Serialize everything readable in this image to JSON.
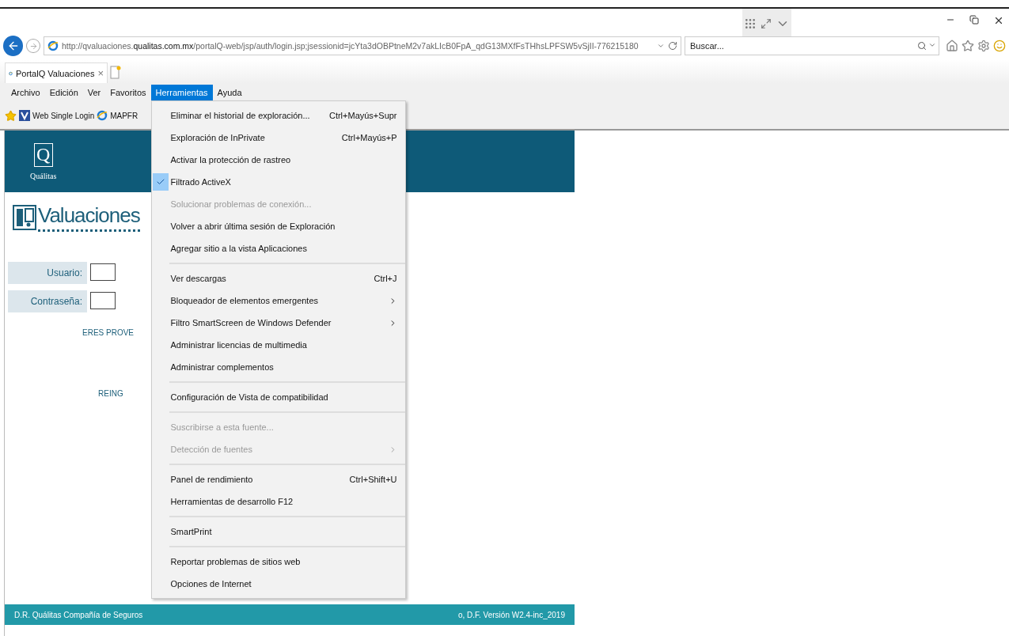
{
  "browser": {
    "address": "http://qvaluaciones.**qualitas.com.mx**/portalQ-web/jsp/auth/login.jsp;jsessionid=jcYta3dOBPtneM2v7akLIcB0FpA_qdG13MXfFsTHhsLPFSW5vSjII-776215180",
    "search_placeholder": "Buscar...",
    "tab": {
      "title": "PortalQ Valuaciones",
      "close": "×"
    }
  },
  "menu_bar": [
    {
      "label": "Archivo",
      "selected": false
    },
    {
      "label": "Edición",
      "selected": false
    },
    {
      "label": "Ver",
      "selected": false
    },
    {
      "label": "Favoritos",
      "selected": false
    },
    {
      "label": "Herramientas",
      "selected": true
    },
    {
      "label": "Ayuda",
      "selected": false
    }
  ],
  "favorites": [
    {
      "label": "Web Single Login",
      "kind": "site"
    },
    {
      "label": "MAPFR",
      "kind": "ie"
    }
  ],
  "tools_menu": [
    {
      "kind": "item",
      "label": "Eliminar el historial de exploración...",
      "shortcut": "Ctrl+Mayús+Supr",
      "checked": false,
      "disabled": false,
      "submenu": false
    },
    {
      "kind": "item",
      "label": "Exploración de InPrivate",
      "shortcut": "Ctrl+Mayús+P",
      "checked": false,
      "disabled": false,
      "submenu": false
    },
    {
      "kind": "item",
      "label": "Activar la protección de rastreo",
      "checked": false,
      "disabled": false,
      "submenu": false
    },
    {
      "kind": "item",
      "label": "Filtrado ActiveX",
      "checked": true,
      "disabled": false,
      "submenu": false
    },
    {
      "kind": "item",
      "label": "Solucionar problemas de conexión...",
      "checked": false,
      "disabled": true,
      "submenu": false
    },
    {
      "kind": "item",
      "label": "Volver a abrir última sesión de Exploración",
      "checked": false,
      "disabled": false,
      "submenu": false
    },
    {
      "kind": "item",
      "label": "Agregar sitio a la vista Aplicaciones",
      "checked": false,
      "disabled": false,
      "submenu": false
    },
    {
      "kind": "separator"
    },
    {
      "kind": "item",
      "label": "Ver descargas",
      "shortcut": "Ctrl+J",
      "checked": false,
      "disabled": false,
      "submenu": false
    },
    {
      "kind": "item",
      "label": "Bloqueador de elementos emergentes",
      "checked": false,
      "disabled": false,
      "submenu": true
    },
    {
      "kind": "item",
      "label": "Filtro SmartScreen de Windows Defender",
      "checked": false,
      "disabled": false,
      "submenu": true
    },
    {
      "kind": "item",
      "label": "Administrar licencias de multimedia",
      "checked": false,
      "disabled": false,
      "submenu": false
    },
    {
      "kind": "item",
      "label": "Administrar complementos",
      "checked": false,
      "disabled": false,
      "submenu": false
    },
    {
      "kind": "separator"
    },
    {
      "kind": "item",
      "label": "Configuración de Vista de compatibilidad",
      "checked": false,
      "disabled": false,
      "submenu": false
    },
    {
      "kind": "separator"
    },
    {
      "kind": "item",
      "label": "Suscribirse a esta fuente...",
      "checked": false,
      "disabled": true,
      "submenu": false
    },
    {
      "kind": "item",
      "label": "Detección de fuentes",
      "checked": false,
      "disabled": true,
      "submenu": true
    },
    {
      "kind": "separator"
    },
    {
      "kind": "item",
      "label": "Panel de rendimiento",
      "shortcut": "Ctrl+Shift+U",
      "checked": false,
      "disabled": false,
      "submenu": false
    },
    {
      "kind": "item",
      "label": "Herramientas de desarrollo F12",
      "checked": false,
      "disabled": false,
      "submenu": false
    },
    {
      "kind": "separator"
    },
    {
      "kind": "item",
      "label": "SmartPrint",
      "checked": false,
      "disabled": false,
      "submenu": false
    },
    {
      "kind": "separator"
    },
    {
      "kind": "item",
      "label": "Reportar problemas de sitios web",
      "checked": false,
      "disabled": false,
      "submenu": false
    },
    {
      "kind": "item",
      "label": "Opciones de Internet",
      "checked": false,
      "disabled": false,
      "submenu": false
    }
  ],
  "page": {
    "logo_letter": "Q",
    "logo_name": "Quálitas",
    "app_title": "Valuaciones",
    "fields": [
      {
        "label": "Usuario:"
      },
      {
        "label": "Contraseña:"
      }
    ],
    "links": [
      "ERES PROVE",
      "REING"
    ],
    "footer_left": "D.R. Quálitas Compañía de Seguros",
    "footer_right": "o, D.F. Versión W2.4-inc_2019"
  }
}
